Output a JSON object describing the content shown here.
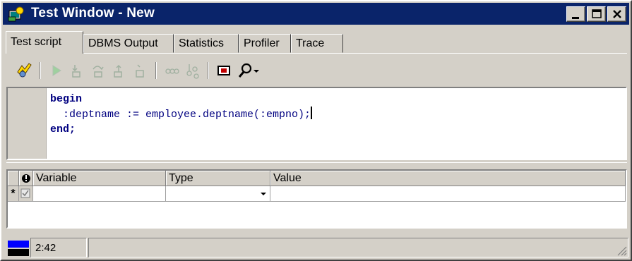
{
  "window": {
    "title": "Test Window - New",
    "title_bar_color": "#0a246a",
    "icons": [
      "app-icon",
      "minimize-icon",
      "maximize-icon",
      "close-icon"
    ]
  },
  "tabs": [
    {
      "label": "Test script",
      "active": true
    },
    {
      "label": "DBMS Output",
      "active": false
    },
    {
      "label": "Statistics",
      "active": false
    },
    {
      "label": "Profiler",
      "active": false
    },
    {
      "label": "Trace",
      "active": false
    }
  ],
  "toolbar": {
    "buttons": [
      "execute-icon",
      "start-icon",
      "step-into-icon",
      "step-over-icon",
      "step-out-icon",
      "run-to-exception-icon",
      "toggle-breakpoint-icon",
      "watch-icon",
      "display-icon",
      "search-icon",
      "dropdown-arrow-icon"
    ]
  },
  "editor": {
    "lines": [
      "begin",
      "  :deptname := employee.deptname(:empno);",
      "end;"
    ]
  },
  "variables": {
    "columns": [
      "",
      "Variable",
      "Type",
      "Value"
    ],
    "new_row_marker": "*",
    "rows": [
      {
        "checked": true,
        "variable": "",
        "type": "",
        "value": ""
      }
    ]
  },
  "status": {
    "position": "2:42",
    "colors": {
      "top": "#0000ff",
      "bottom": "#000000"
    }
  }
}
